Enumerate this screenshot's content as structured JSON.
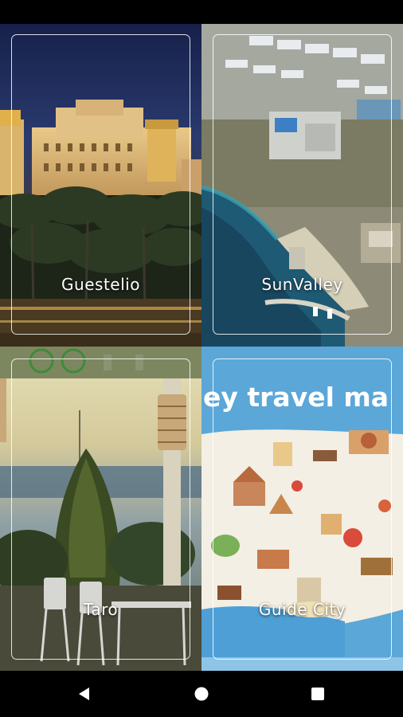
{
  "destinations": [
    {
      "name": "Guestelio"
    },
    {
      "name": "SunValley"
    },
    {
      "name": "Taro"
    },
    {
      "name": "Guide City",
      "banner_text": "ey travel ma"
    }
  ],
  "navigation": {
    "icons": [
      "back-triangle-icon",
      "home-circle-icon",
      "recents-square-icon"
    ]
  },
  "colors": {
    "background": "#000000",
    "label": "#ffffff",
    "frame": "#ffffff"
  }
}
